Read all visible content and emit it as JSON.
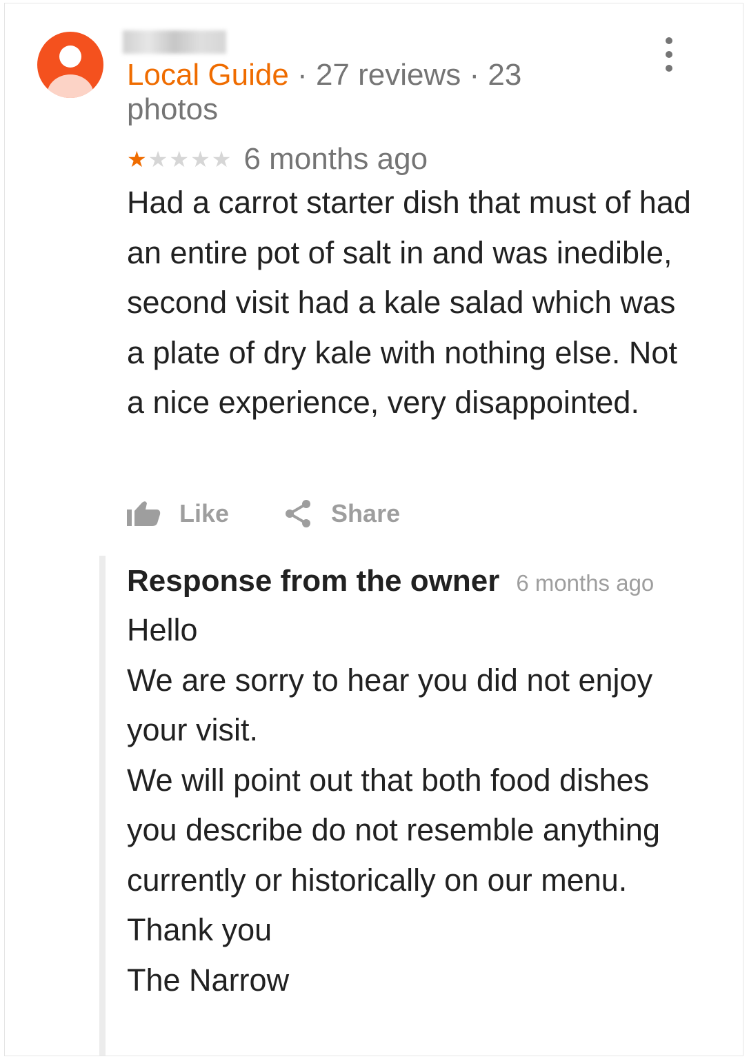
{
  "reviewer": {
    "name": "",
    "badge": "Local Guide",
    "reviews": "27 reviews",
    "photos": "23 photos",
    "separator": " · "
  },
  "review": {
    "rating": 1,
    "rating_max": 5,
    "time": "6 months ago",
    "text": "Had a carrot starter dish that must of had an entire pot of salt in and was inedible, second visit had a kale salad which was a plate of dry kale with nothing  else.  Not a nice experience, very disappointed."
  },
  "actions": {
    "like_label": "Like",
    "share_label": "Share"
  },
  "owner_response": {
    "title": "Response from the owner",
    "time": "6 months ago",
    "text": "Hello\nWe are sorry to hear you did not enjoy your visit.\nWe will point out that both food dishes you describe do not resemble anything currently or historically on our menu.\nThank you\nThe Narrow"
  },
  "icons": {
    "avatar": "person-icon",
    "menu": "more-vert-icon",
    "like": "thumb-up-icon",
    "share": "share-icon"
  },
  "colors": {
    "accent": "#ef6c00",
    "avatar_bg": "#f4511e",
    "secondary_text": "#757575",
    "star_empty": "#d6d6d6"
  }
}
